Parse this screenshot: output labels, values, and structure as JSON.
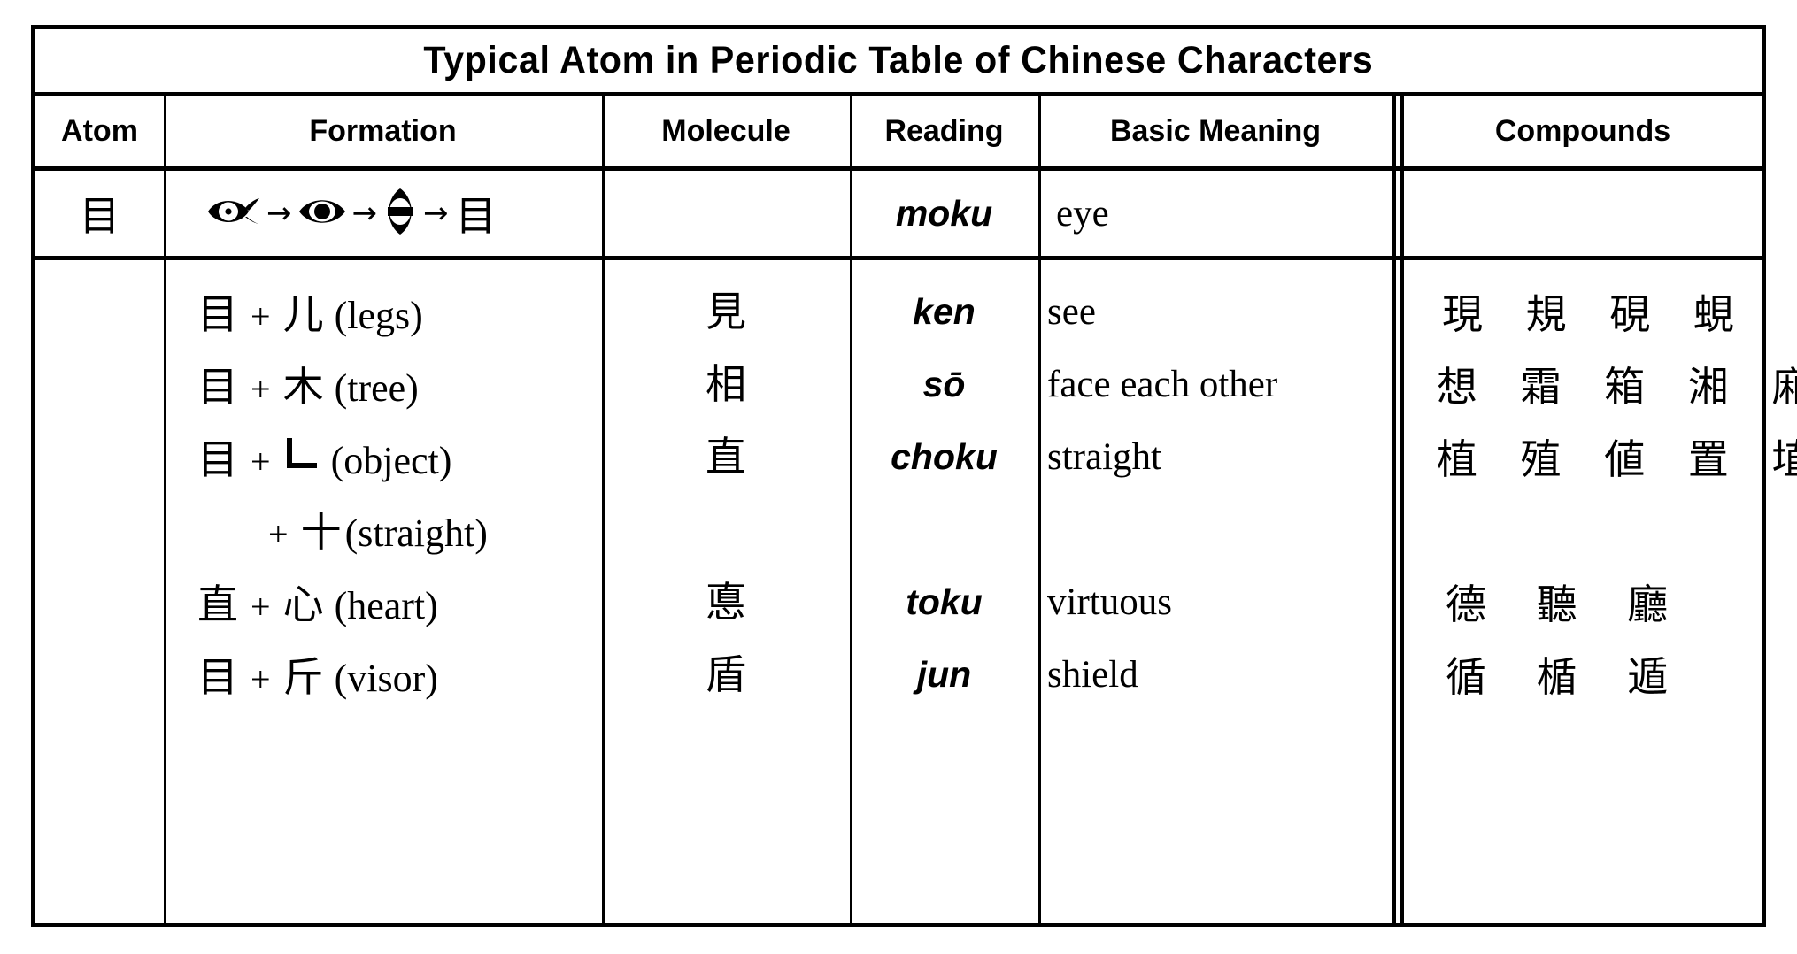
{
  "title": "Typical Atom in Periodic Table of Chinese Characters",
  "columns": {
    "atom": "Atom",
    "formation": "Formation",
    "molecule": "Molecule",
    "reading": "Reading",
    "meaning": "Basic Meaning",
    "compounds": "Compounds"
  },
  "atom_row": {
    "atom": "目",
    "evolution": {
      "steps": [
        "eye-pictograph-horizontal",
        "eye-pictograph-simplified",
        "eye-pictograph-vertical",
        "目"
      ],
      "arrow": "→"
    },
    "molecule": "",
    "reading": "moku",
    "meaning": "eye",
    "compounds": ""
  },
  "rows": [
    {
      "formation": {
        "base": "目",
        "plus": "+",
        "part": "儿",
        "gloss": "(legs)"
      },
      "molecule": "見",
      "reading": "ken",
      "meaning": "see",
      "compounds": [
        "現",
        "規",
        "硯",
        "蜆"
      ]
    },
    {
      "formation": {
        "base": "目",
        "plus": "+",
        "part": "木",
        "gloss": "(tree)"
      },
      "molecule": "相",
      "reading": "sō",
      "meaning": "face each other",
      "compounds": [
        "想",
        "霜",
        "箱",
        "湘",
        "廂"
      ]
    },
    {
      "formation": {
        "base": "目",
        "plus": "+",
        "part": "∟",
        "gloss": "(object)"
      },
      "molecule": "直",
      "reading": "choku",
      "meaning": "straight",
      "compounds": [
        "植",
        "殖",
        "値",
        "置",
        "埴"
      ]
    },
    {
      "formation": {
        "base": "",
        "plus": "+",
        "part": "十",
        "gloss": "(straight)"
      },
      "molecule": "",
      "reading": "",
      "meaning": "",
      "compounds": []
    },
    {
      "formation": {
        "base": "直",
        "plus": "+",
        "part": "心",
        "gloss": "(heart)"
      },
      "molecule": "悳",
      "reading": "toku",
      "meaning": "virtuous",
      "compounds": [
        "德",
        "聽",
        "廳"
      ]
    },
    {
      "formation": {
        "base": "目",
        "plus": "+",
        "part": "斤",
        "gloss": "(visor)"
      },
      "molecule": "盾",
      "reading": "jun",
      "meaning": "shield",
      "compounds": [
        "循",
        "楯",
        "遁"
      ]
    }
  ],
  "colors": {
    "ink": "#000000",
    "paper": "#ffffff"
  }
}
